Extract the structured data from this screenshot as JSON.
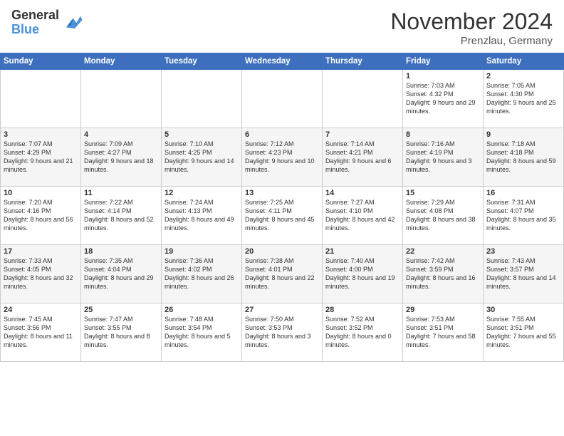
{
  "logo": {
    "general": "General",
    "blue": "Blue"
  },
  "header": {
    "month_year": "November 2024",
    "location": "Prenzlau, Germany"
  },
  "weekdays": [
    "Sunday",
    "Monday",
    "Tuesday",
    "Wednesday",
    "Thursday",
    "Friday",
    "Saturday"
  ],
  "weeks": [
    [
      {
        "day": "",
        "info": ""
      },
      {
        "day": "",
        "info": ""
      },
      {
        "day": "",
        "info": ""
      },
      {
        "day": "",
        "info": ""
      },
      {
        "day": "",
        "info": ""
      },
      {
        "day": "1",
        "info": "Sunrise: 7:03 AM\nSunset: 4:32 PM\nDaylight: 9 hours and 29 minutes."
      },
      {
        "day": "2",
        "info": "Sunrise: 7:05 AM\nSunset: 4:30 PM\nDaylight: 9 hours and 25 minutes."
      }
    ],
    [
      {
        "day": "3",
        "info": "Sunrise: 7:07 AM\nSunset: 4:29 PM\nDaylight: 9 hours and 21 minutes."
      },
      {
        "day": "4",
        "info": "Sunrise: 7:09 AM\nSunset: 4:27 PM\nDaylight: 9 hours and 18 minutes."
      },
      {
        "day": "5",
        "info": "Sunrise: 7:10 AM\nSunset: 4:25 PM\nDaylight: 9 hours and 14 minutes."
      },
      {
        "day": "6",
        "info": "Sunrise: 7:12 AM\nSunset: 4:23 PM\nDaylight: 9 hours and 10 minutes."
      },
      {
        "day": "7",
        "info": "Sunrise: 7:14 AM\nSunset: 4:21 PM\nDaylight: 9 hours and 6 minutes."
      },
      {
        "day": "8",
        "info": "Sunrise: 7:16 AM\nSunset: 4:19 PM\nDaylight: 9 hours and 3 minutes."
      },
      {
        "day": "9",
        "info": "Sunrise: 7:18 AM\nSunset: 4:18 PM\nDaylight: 8 hours and 59 minutes."
      }
    ],
    [
      {
        "day": "10",
        "info": "Sunrise: 7:20 AM\nSunset: 4:16 PM\nDaylight: 8 hours and 56 minutes."
      },
      {
        "day": "11",
        "info": "Sunrise: 7:22 AM\nSunset: 4:14 PM\nDaylight: 8 hours and 52 minutes."
      },
      {
        "day": "12",
        "info": "Sunrise: 7:24 AM\nSunset: 4:13 PM\nDaylight: 8 hours and 49 minutes."
      },
      {
        "day": "13",
        "info": "Sunrise: 7:25 AM\nSunset: 4:11 PM\nDaylight: 8 hours and 45 minutes."
      },
      {
        "day": "14",
        "info": "Sunrise: 7:27 AM\nSunset: 4:10 PM\nDaylight: 8 hours and 42 minutes."
      },
      {
        "day": "15",
        "info": "Sunrise: 7:29 AM\nSunset: 4:08 PM\nDaylight: 8 hours and 38 minutes."
      },
      {
        "day": "16",
        "info": "Sunrise: 7:31 AM\nSunset: 4:07 PM\nDaylight: 8 hours and 35 minutes."
      }
    ],
    [
      {
        "day": "17",
        "info": "Sunrise: 7:33 AM\nSunset: 4:05 PM\nDaylight: 8 hours and 32 minutes."
      },
      {
        "day": "18",
        "info": "Sunrise: 7:35 AM\nSunset: 4:04 PM\nDaylight: 8 hours and 29 minutes."
      },
      {
        "day": "19",
        "info": "Sunrise: 7:36 AM\nSunset: 4:02 PM\nDaylight: 8 hours and 26 minutes."
      },
      {
        "day": "20",
        "info": "Sunrise: 7:38 AM\nSunset: 4:01 PM\nDaylight: 8 hours and 22 minutes."
      },
      {
        "day": "21",
        "info": "Sunrise: 7:40 AM\nSunset: 4:00 PM\nDaylight: 8 hours and 19 minutes."
      },
      {
        "day": "22",
        "info": "Sunrise: 7:42 AM\nSunset: 3:59 PM\nDaylight: 8 hours and 16 minutes."
      },
      {
        "day": "23",
        "info": "Sunrise: 7:43 AM\nSunset: 3:57 PM\nDaylight: 8 hours and 14 minutes."
      }
    ],
    [
      {
        "day": "24",
        "info": "Sunrise: 7:45 AM\nSunset: 3:56 PM\nDaylight: 8 hours and 11 minutes."
      },
      {
        "day": "25",
        "info": "Sunrise: 7:47 AM\nSunset: 3:55 PM\nDaylight: 8 hours and 8 minutes."
      },
      {
        "day": "26",
        "info": "Sunrise: 7:48 AM\nSunset: 3:54 PM\nDaylight: 8 hours and 5 minutes."
      },
      {
        "day": "27",
        "info": "Sunrise: 7:50 AM\nSunset: 3:53 PM\nDaylight: 8 hours and 3 minutes."
      },
      {
        "day": "28",
        "info": "Sunrise: 7:52 AM\nSunset: 3:52 PM\nDaylight: 8 hours and 0 minutes."
      },
      {
        "day": "29",
        "info": "Sunrise: 7:53 AM\nSunset: 3:51 PM\nDaylight: 7 hours and 58 minutes."
      },
      {
        "day": "30",
        "info": "Sunrise: 7:55 AM\nSunset: 3:51 PM\nDaylight: 7 hours and 55 minutes."
      }
    ]
  ]
}
